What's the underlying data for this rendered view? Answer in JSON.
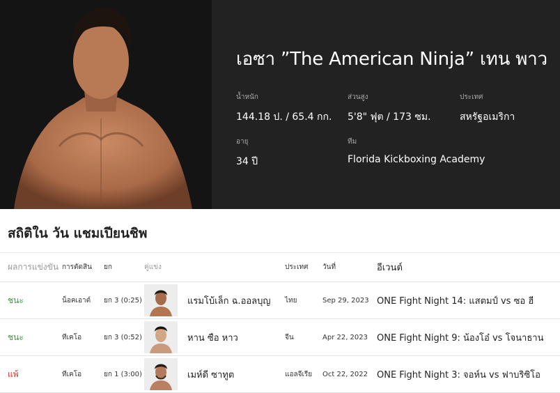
{
  "fighter": {
    "name": "เอซา ”The American Ninja” เทน พาว",
    "stats": {
      "weight": {
        "label": "น้ำหนัก",
        "value": "144.18 ป. / 65.4 กก."
      },
      "height": {
        "label": "ส่วนสูง",
        "value": "5'8\" ฟุต / 173 ซม."
      },
      "country": {
        "label": "ประเทศ",
        "value": "สหรัฐอเมริกา"
      },
      "age": {
        "label": "อายุ",
        "value": "34 ปี"
      },
      "team": {
        "label": "ทีม",
        "value": "Florida Kickboxing Academy"
      }
    }
  },
  "record": {
    "title": "สถิติใน วัน แชมเปียนชิพ",
    "headers": {
      "result": "ผลการแข่งขัน",
      "method": "การตัดสิน",
      "round": "ยก",
      "opponent": "คู่แข่ง",
      "country": "ประเทศ",
      "date": "วันที่",
      "event": "อีเวนต์"
    },
    "rows": [
      {
        "result": "ชนะ",
        "outcome": "win",
        "method": "น็อคเอาต์",
        "round": "ยก 3 (0:25)",
        "opponent": "แรมโบ้เล็ก ฉ.ออลบุญ",
        "country": "ไทย",
        "date": "Sep 29, 2023",
        "event": "ONE Fight Night 14: แสตมป์ vs ซอ ฮี"
      },
      {
        "result": "ชนะ",
        "outcome": "win",
        "method": "ทีเคโอ",
        "round": "ยก 3 (0:52)",
        "opponent": "หาน ซือ หาว",
        "country": "จีน",
        "date": "Apr 22, 2023",
        "event": "ONE Fight Night 9: น้องโอ๋ vs โจนาธาน"
      },
      {
        "result": "แพ้",
        "outcome": "loss",
        "method": "ทีเคโอ",
        "round": "ยก 1 (3:00)",
        "opponent": "เมห์ดี ซาทูต",
        "country": "แอลจีเรีย",
        "date": "Oct 22, 2022",
        "event": "ONE Fight Night 3: จอห์น vs ฟาบริซิโอ"
      }
    ]
  },
  "colors": {
    "win": "#3a9a3c",
    "loss": "#d6332d",
    "hero_bg": "#222223"
  }
}
